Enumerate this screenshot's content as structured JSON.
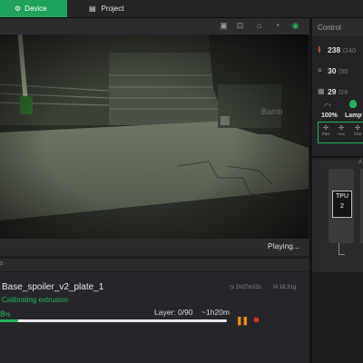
{
  "tabs": {
    "device_label": "Device",
    "device_icon": "device-icon",
    "project_label": "Project",
    "project_icon": "project-icon"
  },
  "camera": {
    "playing_label": "Playing..."
  },
  "status": {
    "job_name": "Base_spoiler_v2_plate_1",
    "stage": "Calibrating extrusion",
    "time_estimate": "1h27m22s",
    "weight": "18.31g",
    "progress_label": "8",
    "progress_unit": "%",
    "progress_fraction": 0.08,
    "layer": "Layer: 0/90",
    "remaining": "~1h20m"
  },
  "control": {
    "title": "Control",
    "nozzle_temp": "238",
    "nozzle_target": "/240",
    "bed_temp": "30",
    "bed_target": "/30",
    "chamber_temp": "29",
    "chamber_target": "/29",
    "speed": "100%",
    "lamp_label": "Lamp",
    "fans": [
      {
        "label": "Part"
      },
      {
        "label": "Aux"
      },
      {
        "label": "Cha"
      }
    ],
    "ams_slot_label": "TPU",
    "ams_slot_sub": "2",
    "ams_unit": "A"
  },
  "colors": {
    "accent": "#1fa25a",
    "pause": "#f08a1c",
    "stop": "#d9302c"
  }
}
